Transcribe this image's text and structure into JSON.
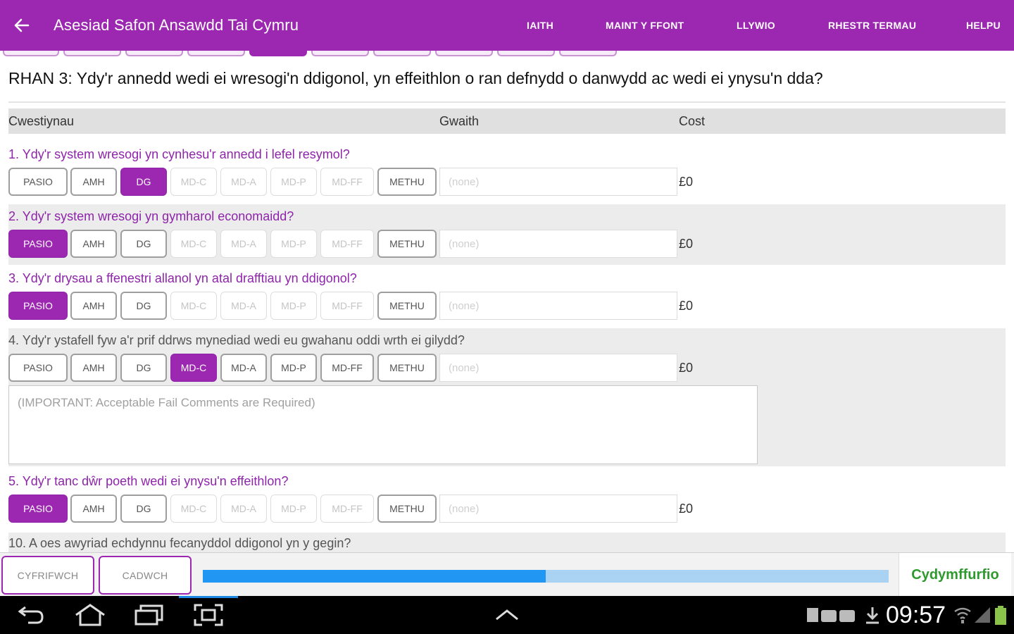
{
  "appbar": {
    "title": "Asesiad Safon Ansawdd Tai Cymru",
    "menu": [
      "IAITH",
      "MAINT Y FFONT",
      "LLYWIO",
      "RHESTR TERMAU",
      "HELPU"
    ],
    "accent": "#9c27b0"
  },
  "section": {
    "title": "RHAN 3: Ydy'r annedd wedi ei wresogi'n ddigonol, yn effeithlon o ran defnydd o danwydd ac wedi ei ynysu'n dda?"
  },
  "table_header": {
    "questions": "Cwestiynau",
    "work": "Gwaith",
    "cost": "Cost"
  },
  "questions": [
    {
      "text": "1. Ydy'r system wresogi yn cynhesu'r annedd i lefel resymol?",
      "selected": "DG",
      "work_placeholder": "(none)",
      "cost": "£0"
    },
    {
      "text": "2. Ydy'r system wresogi yn gymharol economaidd?",
      "selected": "PASIO",
      "work_placeholder": "(none)",
      "cost": "£0"
    },
    {
      "text": "3. Ydy'r drysau a ffenestri allanol yn atal drafftiau yn ddigonol?",
      "selected": "PASIO",
      "work_placeholder": "(none)",
      "cost": "£0"
    },
    {
      "text": "4. Ydy'r ystafell fyw a'r prif ddrws mynediad wedi eu gwahanu oddi wrth ei gilydd?",
      "selected": "MD-C",
      "work_placeholder": "(none)",
      "cost": "£0",
      "comment_placeholder": "(IMPORTANT: Acceptable Fail Comments are Required)"
    },
    {
      "text": "5. Ydy'r tanc dŵr poeth wedi ei ynysu'n effeithlon?",
      "selected": "PASIO",
      "work_placeholder": "(none)",
      "cost": "£0"
    },
    {
      "text": "10. A oes awyriad echdynnu fecanyddol ddigonol yn y gegin?"
    }
  ],
  "options": [
    "PASIO",
    "AMH",
    "DG",
    "MD-C",
    "MD-A",
    "MD-P",
    "MD-FF",
    "METHU"
  ],
  "bottom": {
    "calculate": "CYFRIFWCH",
    "save": "CADWCH",
    "progress": 0.5,
    "status": "Cydymffurfio"
  },
  "system": {
    "time": "09:57"
  },
  "icons": [
    "back-arrow-icon",
    "nav-back-icon",
    "nav-home-icon",
    "nav-recents-icon",
    "screenshot-icon",
    "nav-up-chevron-icon",
    "notification-icon",
    "download-icon",
    "wifi-icon",
    "signal-icon",
    "battery-icon"
  ]
}
